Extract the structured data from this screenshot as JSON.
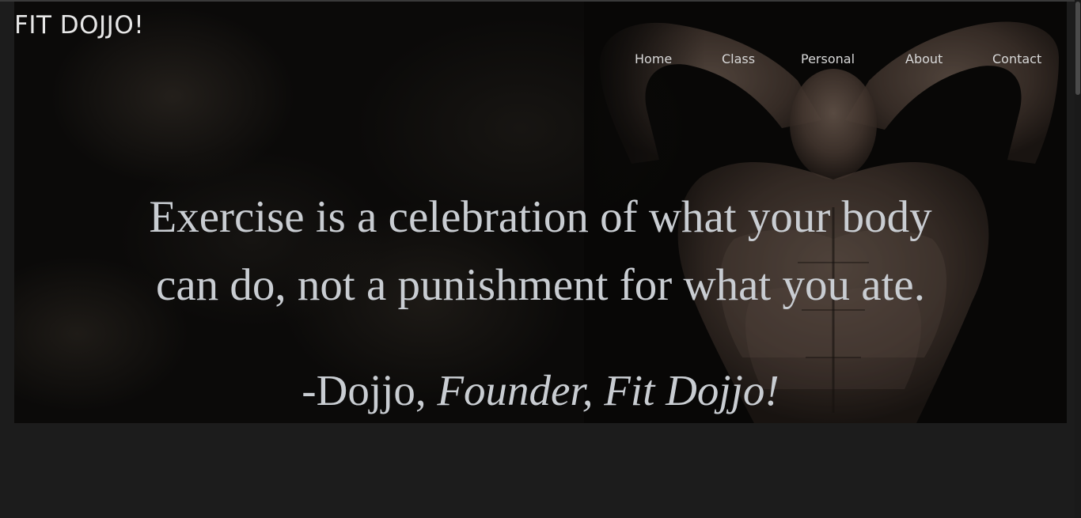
{
  "site": {
    "logo": "FIT DOJJO!"
  },
  "nav": {
    "items": [
      {
        "label": "Home"
      },
      {
        "label": "Class"
      },
      {
        "label": "Personal"
      },
      {
        "label": "About"
      },
      {
        "label": "Contact"
      }
    ]
  },
  "hero": {
    "quote_line1": "Exercise is a celebration of what your body",
    "quote_line2": "can do, not a punishment for what you ate.",
    "attribution_name": "-Dojjo,",
    "attribution_role": "Founder, Fit Dojjo!"
  },
  "colors": {
    "page_background": "#1c1c1c",
    "hero_background": "#0b0a09",
    "text": "#c9cdd2",
    "nav_text": "#d8d8d8"
  }
}
